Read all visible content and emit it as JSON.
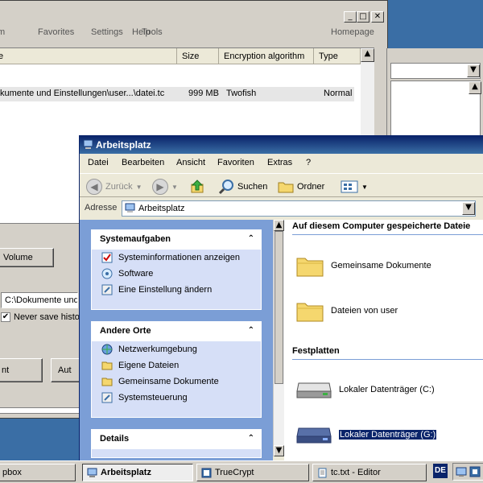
{
  "truecrypt": {
    "menu": [
      "m",
      "Favorites",
      "Tools",
      "Settings",
      "Help"
    ],
    "homepage": "Homepage",
    "columns": [
      "e",
      "Size",
      "Encryption algorithm",
      "Type"
    ],
    "row": {
      "path": "kumente und Einstellungen\\user...\\datei.tc",
      "size": "999 MB",
      "algorithm": "Twofish",
      "type": "Normal"
    },
    "lower": {
      "volume_button": "Volume",
      "path_value": "C:\\Dokumente und",
      "never_save": "Never save histo",
      "left_button": "nt",
      "right_button": "Aut"
    }
  },
  "explorer": {
    "title": "Arbeitsplatz",
    "menu": [
      "Datei",
      "Bearbeiten",
      "Ansicht",
      "Favoriten",
      "Extras",
      "?"
    ],
    "toolbar": {
      "back": "Zurück",
      "search": "Suchen",
      "folders": "Ordner"
    },
    "address_label": "Adresse",
    "address_value": "Arbeitsplatz",
    "taskpane": {
      "system_tasks": {
        "title": "Systemaufgaben",
        "items": [
          "Systeminformationen anzeigen",
          "Software",
          "Eine Einstellung ändern"
        ]
      },
      "other_places": {
        "title": "Andere Orte",
        "items": [
          "Netzwerkumgebung",
          "Eigene Dateien",
          "Gemeinsame Dokumente",
          "Systemsteuerung"
        ]
      },
      "details": {
        "title": "Details"
      }
    },
    "content": {
      "section_files": "Auf diesem Computer gespeicherte Dateie",
      "folders": [
        "Gemeinsame Dokumente",
        "Dateien von user"
      ],
      "section_drives": "Festplatten",
      "drives": [
        "Lokaler Datenträger (C:)",
        "Lokaler Datenträger (G:)"
      ]
    }
  },
  "taskbar": {
    "items": [
      "pbox",
      "Arbeitsplatz",
      "TrueCrypt",
      "tc.txt - Editor"
    ],
    "language": "DE"
  },
  "colors": {
    "desktop": "#3a6ea5",
    "titlebar": "#0a246a",
    "taskpane_bg": "#7b9ed6",
    "selection": "#0a246a"
  }
}
